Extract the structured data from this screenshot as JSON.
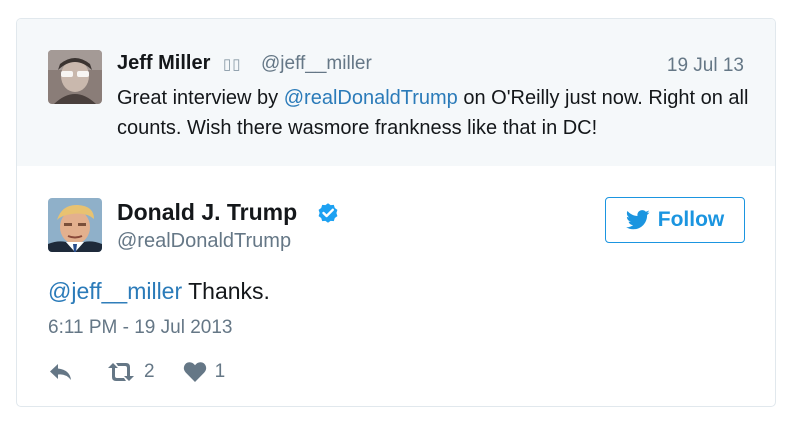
{
  "quoted_tweet": {
    "author_name": "Jeff Miller",
    "name_glyphs": "▯▯",
    "handle": "@jeff__miller",
    "date": "19 Jul 13",
    "text_before": "Great interview by ",
    "mention": "@realDonaldTrump",
    "text_after": " on O'Reilly just now. Right on all counts. Wish there wasmore frankness like that in DC!"
  },
  "main_tweet": {
    "author_name": "Donald J. Trump",
    "handle": "@realDonaldTrump",
    "verified": true,
    "follow_label": "Follow",
    "mention": "@jeff__miller",
    "text_after": " Thanks.",
    "timestamp": "6:11 PM - 19 Jul 2013",
    "retweet_count": "2",
    "like_count": "1"
  },
  "colors": {
    "link": "#2b7bb9",
    "follow_accent": "#1b95e0",
    "verified_badge": "#1da1f2",
    "muted_text": "#657786",
    "quoted_background": "#f5f8fa"
  },
  "icons": {
    "reply": "reply-arrow-icon",
    "retweet": "retweet-icon",
    "like": "heart-icon",
    "follow": "bird-icon",
    "verified": "verified-badge-icon"
  }
}
